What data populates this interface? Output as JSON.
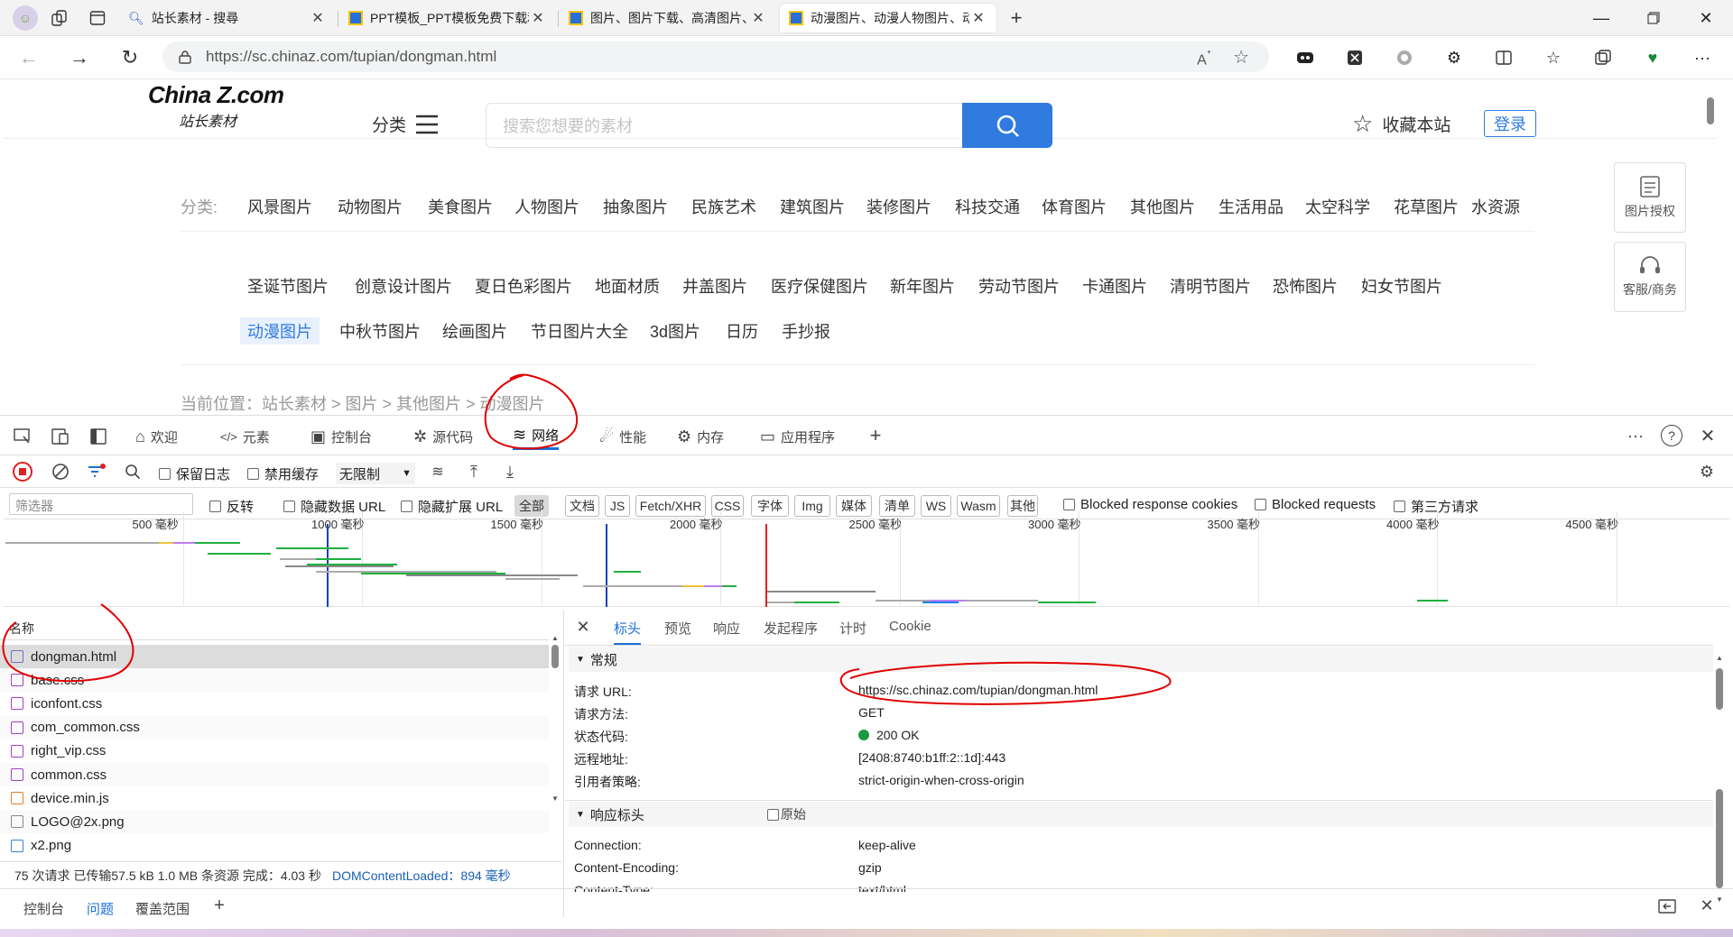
{
  "browser": {
    "tabs": [
      {
        "title": "站长素材 - 搜尋",
        "icon": "search-icon"
      },
      {
        "title": "PPT模板_PPT模板免费下载和在线",
        "icon": "favicon-icon"
      },
      {
        "title": "图片、图片下载、高清图片、图片",
        "icon": "favicon-icon"
      },
      {
        "title": "动漫图片、动漫人物图片、动漫图",
        "icon": "favicon-icon"
      }
    ],
    "url": "https://sc.chinaz.com/tupian/dongman.html"
  },
  "site": {
    "logo_main": "China Z.com",
    "logo_sub": "站长素材",
    "fenlei": "分类",
    "search_placeholder": "搜索您想要的素材",
    "favorite": "收藏本站",
    "login": "登录",
    "side_btn1": "图片授权",
    "side_btn2": "客服/商务",
    "cat_label": "分类:",
    "cats_row1": [
      "风景图片",
      "动物图片",
      "美食图片",
      "人物图片",
      "抽象图片",
      "民族艺术",
      "建筑图片",
      "装修图片",
      "科技交通",
      "体育图片",
      "其他图片",
      "生活用品",
      "太空科学",
      "花草图片",
      "水资源"
    ],
    "cats_row2": [
      "圣诞节图片",
      "创意设计图片",
      "夏日色彩图片",
      "地面材质",
      "井盖图片",
      "医疗保健图片",
      "新年图片",
      "劳动节图片",
      "卡通图片",
      "清明节图片",
      "恐怖图片",
      "妇女节图片"
    ],
    "cats_row3": [
      "动漫图片",
      "中秋节图片",
      "绘画图片",
      "节日图片大全",
      "3d图片",
      "日历",
      "手抄报"
    ],
    "breadcrumb": "当前位置：站长素材 > 图片 > 其他图片 > 动漫图片"
  },
  "devtools": {
    "tabs": [
      "欢迎",
      "元素",
      "控制台",
      "源代码",
      "网络",
      "性能",
      "内存",
      "应用程序"
    ],
    "toolbar": {
      "preserve_log": "保留日志",
      "disable_cache": "禁用缓存",
      "throttle": "无限制"
    },
    "filter": {
      "placeholder": "筛选器",
      "invert": "反转",
      "hide_data": "隐藏数据 URL",
      "hide_ext": "隐藏扩展 URL",
      "chips": [
        "全部",
        "文档",
        "JS",
        "Fetch/XHR",
        "CSS",
        "字体",
        "Img",
        "媒体",
        "清单",
        "WS",
        "Wasm",
        "其他"
      ],
      "blocked_cookies": "Blocked response cookies",
      "blocked_req": "Blocked requests",
      "third_party": "第三方请求"
    },
    "waterfall_labels": [
      "500 毫秒",
      "1000 毫秒",
      "1500 毫秒",
      "2000 毫秒",
      "2500 毫秒",
      "3000 毫秒",
      "3500 毫秒",
      "4000 毫秒",
      "4500 毫秒"
    ],
    "name_header": "名称",
    "requests": [
      "dongman.html",
      "base.css",
      "iconfont.css",
      "com_common.css",
      "right_vip.css",
      "common.css",
      "device.min.js",
      "LOGO@2x.png",
      "x2.png"
    ],
    "status": {
      "summary": "75 次请求  已传输57.5 kB  1.0 MB 条资源  完成：4.03 秒",
      "dcl": "DOMContentLoaded：894 毫秒"
    },
    "detail_tabs": [
      "标头",
      "预览",
      "响应",
      "发起程序",
      "计时",
      "Cookie"
    ],
    "general": {
      "title": "常规",
      "rows": [
        {
          "k": "请求 URL:",
          "v": "https://sc.chinaz.com/tupian/dongman.html"
        },
        {
          "k": "请求方法:",
          "v": "GET"
        },
        {
          "k": "状态代码:",
          "v": "200 OK"
        },
        {
          "k": "远程地址:",
          "v": "[2408:8740:b1ff:2::1d]:443"
        },
        {
          "k": "引用者策略:",
          "v": "strict-origin-when-cross-origin"
        }
      ]
    },
    "resp": {
      "title": "响应标头",
      "raw": "原始",
      "rows": [
        {
          "k": "Connection:",
          "v": "keep-alive"
        },
        {
          "k": "Content-Encoding:",
          "v": "gzip"
        },
        {
          "k": "Content-Type:",
          "v": "text/html"
        }
      ]
    },
    "bottom": [
      "控制台",
      "问题",
      "覆盖范围"
    ]
  },
  "colors": {
    "accent": "#2f7be0",
    "annot": "#e00000"
  }
}
